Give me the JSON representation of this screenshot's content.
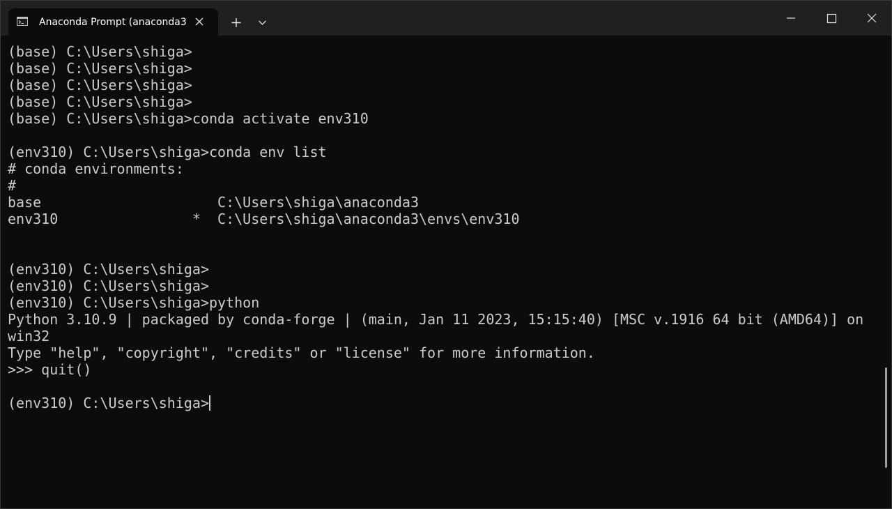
{
  "tab": {
    "title": "Anaconda Prompt (anaconda3",
    "icon": "console-icon"
  },
  "titlebar_buttons": {
    "new_tab": "plus-icon",
    "dropdown": "chevron-down-icon",
    "minimize": "minimize-icon",
    "maximize": "maximize-icon",
    "close": "close-icon"
  },
  "terminal": {
    "lines": [
      "(base) C:\\Users\\shiga>",
      "(base) C:\\Users\\shiga>",
      "(base) C:\\Users\\shiga>",
      "(base) C:\\Users\\shiga>",
      "(base) C:\\Users\\shiga>conda activate env310",
      "",
      "(env310) C:\\Users\\shiga>conda env list",
      "# conda environments:",
      "#",
      "base                     C:\\Users\\shiga\\anaconda3",
      "env310                *  C:\\Users\\shiga\\anaconda3\\envs\\env310",
      "",
      "",
      "(env310) C:\\Users\\shiga>",
      "(env310) C:\\Users\\shiga>",
      "(env310) C:\\Users\\shiga>python",
      "Python 3.10.9 | packaged by conda-forge | (main, Jan 11 2023, 15:15:40) [MSC v.1916 64 bit (AMD64)] on",
      "win32",
      "Type \"help\", \"copyright\", \"credits\" or \"license\" for more information.",
      ">>> quit()",
      ""
    ],
    "prompt_line": "(env310) C:\\Users\\shiga>"
  },
  "colors": {
    "background": "#0c0c0c",
    "titlebar": "#202020",
    "text": "#cccccc"
  }
}
